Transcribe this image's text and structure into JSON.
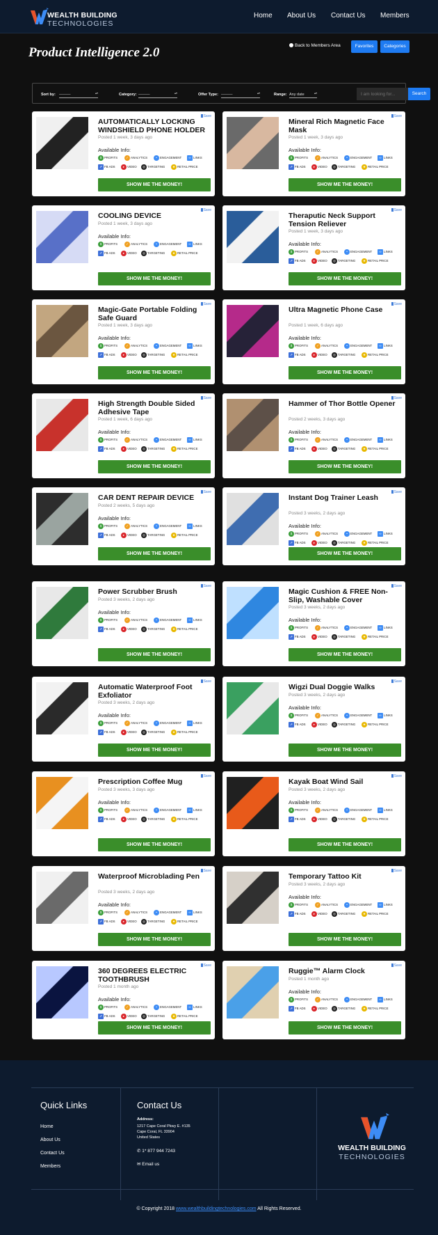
{
  "brand": {
    "line1": "WEALTH BUILDING",
    "line2": "TECHNOLOGIES"
  },
  "nav": [
    "Home",
    "About Us",
    "Contact Us",
    "Members"
  ],
  "page_title": "Product Intelligence 2.0",
  "back_link": "Back to Members Area",
  "favorites_label": "Favorites",
  "categories_label": "Categories",
  "filters": {
    "sort_label": "Sort by:",
    "sort_value": "———",
    "category_label": "Category:",
    "category_value": "———",
    "offer_label": "Offer Type:",
    "offer_value": "———",
    "range_label": "Range:",
    "range_value": "Any date",
    "search_placeholder": "I am looking for...",
    "search_button": "Search"
  },
  "card_labels": {
    "save": "Save",
    "available": "Available Info:",
    "button": "SHOW ME THE MONEY!",
    "tags": [
      "PROFITS",
      "ANALYTICS",
      "ENGAGEMENT",
      "LINKS",
      "FB ADS",
      "VIDEO",
      "TARGETING",
      "RETAIL PRICE"
    ]
  },
  "products": [
    {
      "title": "AUTOMATICALLY LOCKING WINDSHIELD PHONE HOLDER",
      "posted": "Posted 1 week, 3 days ago"
    },
    {
      "title": "Mineral Rich Magnetic Face Mask",
      "posted": "Posted 1 week, 3 days ago"
    },
    {
      "title": "COOLING DEVICE",
      "posted": "Posted 1 week, 3 days ago"
    },
    {
      "title": "Theraputic Neck Support Tension Reliever",
      "posted": "Posted 1 week, 3 days ago"
    },
    {
      "title": "Magic-Gate Portable Folding Safe Guard",
      "posted": "Posted 1 week, 3 days ago"
    },
    {
      "title": "Ultra Magnetic Phone Case",
      "posted": "Posted 1 week, 6 days ago"
    },
    {
      "title": "High Strength Double Sided Adhesive Tape",
      "posted": "Posted 1 week, 6 days ago"
    },
    {
      "title": "Hammer of Thor Bottle Opener",
      "posted": "Posted 2 weeks, 3 days ago"
    },
    {
      "title": "CAR DENT REPAIR DEVICE",
      "posted": "Posted 2 weeks, 5 days ago"
    },
    {
      "title": "Instant Dog Trainer Leash",
      "posted": "Posted 3 weeks, 2 days ago"
    },
    {
      "title": "Power Scrubber Brush",
      "posted": "Posted 3 weeks, 2 days ago"
    },
    {
      "title": "Magic Cushion & FREE Non-Slip, Washable Cover",
      "posted": "Posted 3 weeks, 2 days ago"
    },
    {
      "title": "Automatic Waterproof Foot Exfoliator",
      "posted": "Posted 3 weeks, 2 days ago"
    },
    {
      "title": "Wigzi Dual Doggie Walks",
      "posted": "Posted 3 weeks, 2 days ago"
    },
    {
      "title": "Prescription Coffee Mug",
      "posted": "Posted 3 weeks, 3 days ago"
    },
    {
      "title": "Kayak Boat Wind Sail",
      "posted": "Posted 3 weeks, 2 days ago"
    },
    {
      "title": "Waterproof Microblading Pen",
      "posted": "Posted 3 weeks, 2 days ago"
    },
    {
      "title": "Temporary Tattoo Kit",
      "posted": "Posted 3 weeks, 2 days ago"
    },
    {
      "title": "360 DEGREES ELECTRIC TOOTHBRUSH",
      "posted": "Posted 1 month ago"
    },
    {
      "title": "Ruggie™ Alarm Clock",
      "posted": "Posted 1 month ago"
    }
  ],
  "footer": {
    "quick_links_title": "Quick Links",
    "quick_links": [
      "Home",
      "About Us",
      "Contact Us",
      "Members"
    ],
    "contact_title": "Contact Us",
    "address_label": "Address:",
    "address_lines": [
      "1217 Cape Coral Pkwy E. #135",
      "Cape Coral, FL 33904",
      "United States"
    ],
    "phone": "1* 877 944 7243",
    "email": "Email us",
    "copyright_prefix": "© Copyright 2018",
    "copyright_link": "www.wealthbuildingtechnologies.com",
    "copyright_suffix": "All Rights Reserved."
  },
  "colors": {
    "header_bg": "#0d1b2e",
    "accent_blue": "#1e7bf2",
    "button_green": "#3a8e2a",
    "page_bg": "#101010"
  }
}
